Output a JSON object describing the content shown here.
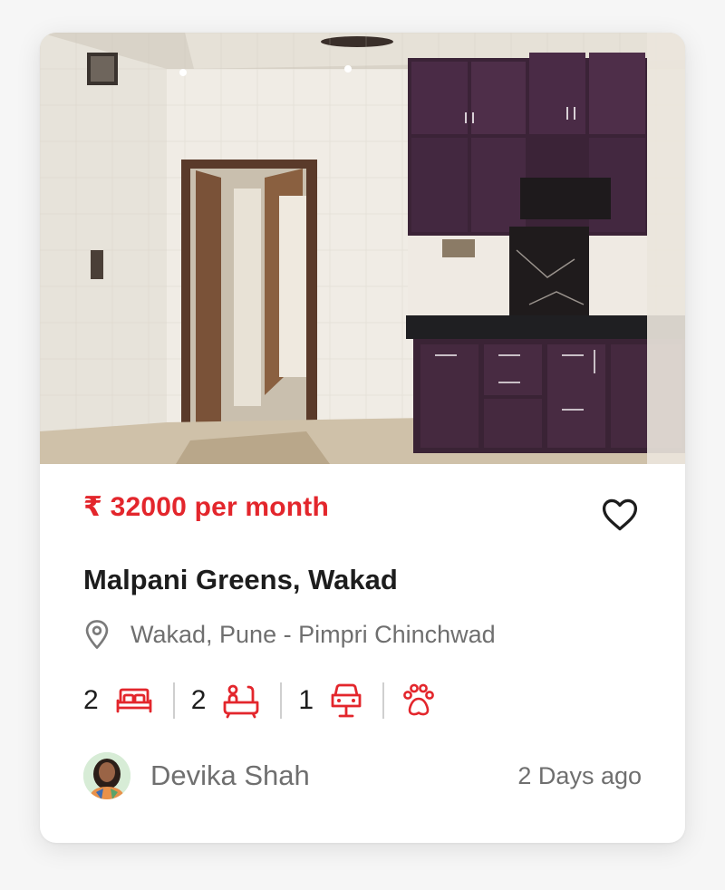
{
  "listing": {
    "price": "₹ 32000 per month",
    "title": "Malpani Greens, Wakad",
    "location": "Wakad, Pune - Pimpri Chinchwad",
    "features": [
      {
        "count": "2",
        "icon": "bed-icon"
      },
      {
        "count": "2",
        "icon": "bathtub-icon"
      },
      {
        "count": "1",
        "icon": "car-icon"
      },
      {
        "count": "",
        "icon": "paw-icon"
      }
    ],
    "owner": "Devika Shah",
    "posted": "2 Days ago",
    "favorited": false
  },
  "colors": {
    "accent": "#e3262c",
    "title": "#1d1d1d",
    "muted": "#6f6f6f",
    "card": "#ffffff",
    "page": "#f6f6f6"
  }
}
